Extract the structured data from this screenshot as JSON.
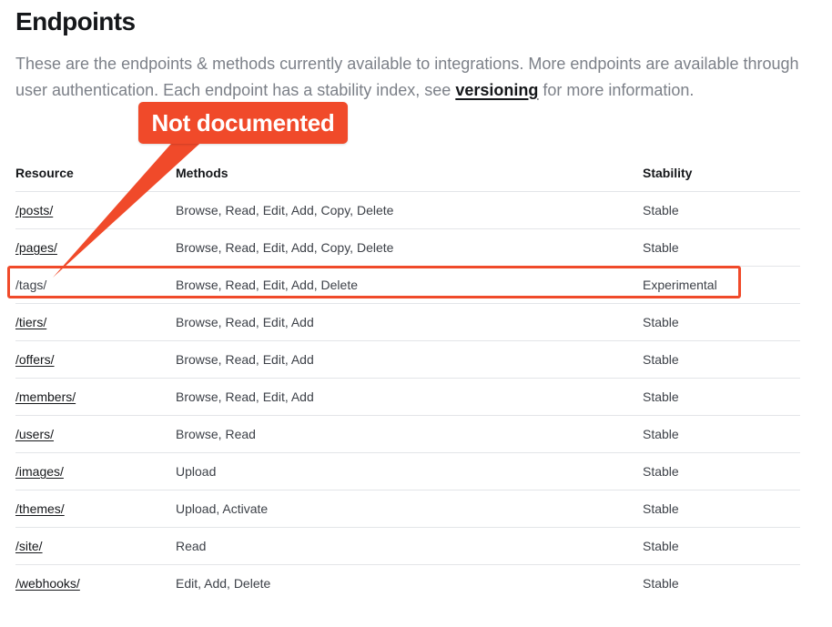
{
  "heading": "Endpoints",
  "intro": {
    "text_before": "These are the endpoints & methods currently available to integrations. More endpoints are available through user authentication. Each endpoint has a stability index, see ",
    "link_text": "versioning",
    "text_after": " for more information."
  },
  "table": {
    "headers": [
      "Resource",
      "Methods",
      "Stability"
    ],
    "rows": [
      {
        "resource": "/posts/",
        "linked": true,
        "methods": "Browse, Read, Edit, Add, Copy, Delete",
        "stability": "Stable"
      },
      {
        "resource": "/pages/",
        "linked": true,
        "methods": "Browse, Read, Edit, Add, Copy, Delete",
        "stability": "Stable"
      },
      {
        "resource": "/tags/",
        "linked": false,
        "methods": "Browse, Read, Edit, Add, Delete",
        "stability": "Experimental"
      },
      {
        "resource": "/tiers/",
        "linked": true,
        "methods": "Browse, Read, Edit, Add",
        "stability": "Stable"
      },
      {
        "resource": "/offers/",
        "linked": true,
        "methods": "Browse, Read, Edit, Add",
        "stability": "Stable"
      },
      {
        "resource": "/members/",
        "linked": true,
        "methods": "Browse, Read, Edit, Add",
        "stability": "Stable"
      },
      {
        "resource": "/users/",
        "linked": true,
        "methods": "Browse, Read",
        "stability": "Stable"
      },
      {
        "resource": "/images/",
        "linked": true,
        "methods": "Upload",
        "stability": "Stable"
      },
      {
        "resource": "/themes/",
        "linked": true,
        "methods": "Upload, Activate",
        "stability": "Stable"
      },
      {
        "resource": "/site/",
        "linked": true,
        "methods": "Read",
        "stability": "Stable"
      },
      {
        "resource": "/webhooks/",
        "linked": true,
        "methods": "Edit, Add, Delete",
        "stability": "Stable"
      }
    ]
  },
  "annotation": {
    "label": "Not documented",
    "color": "#f04a2a"
  }
}
